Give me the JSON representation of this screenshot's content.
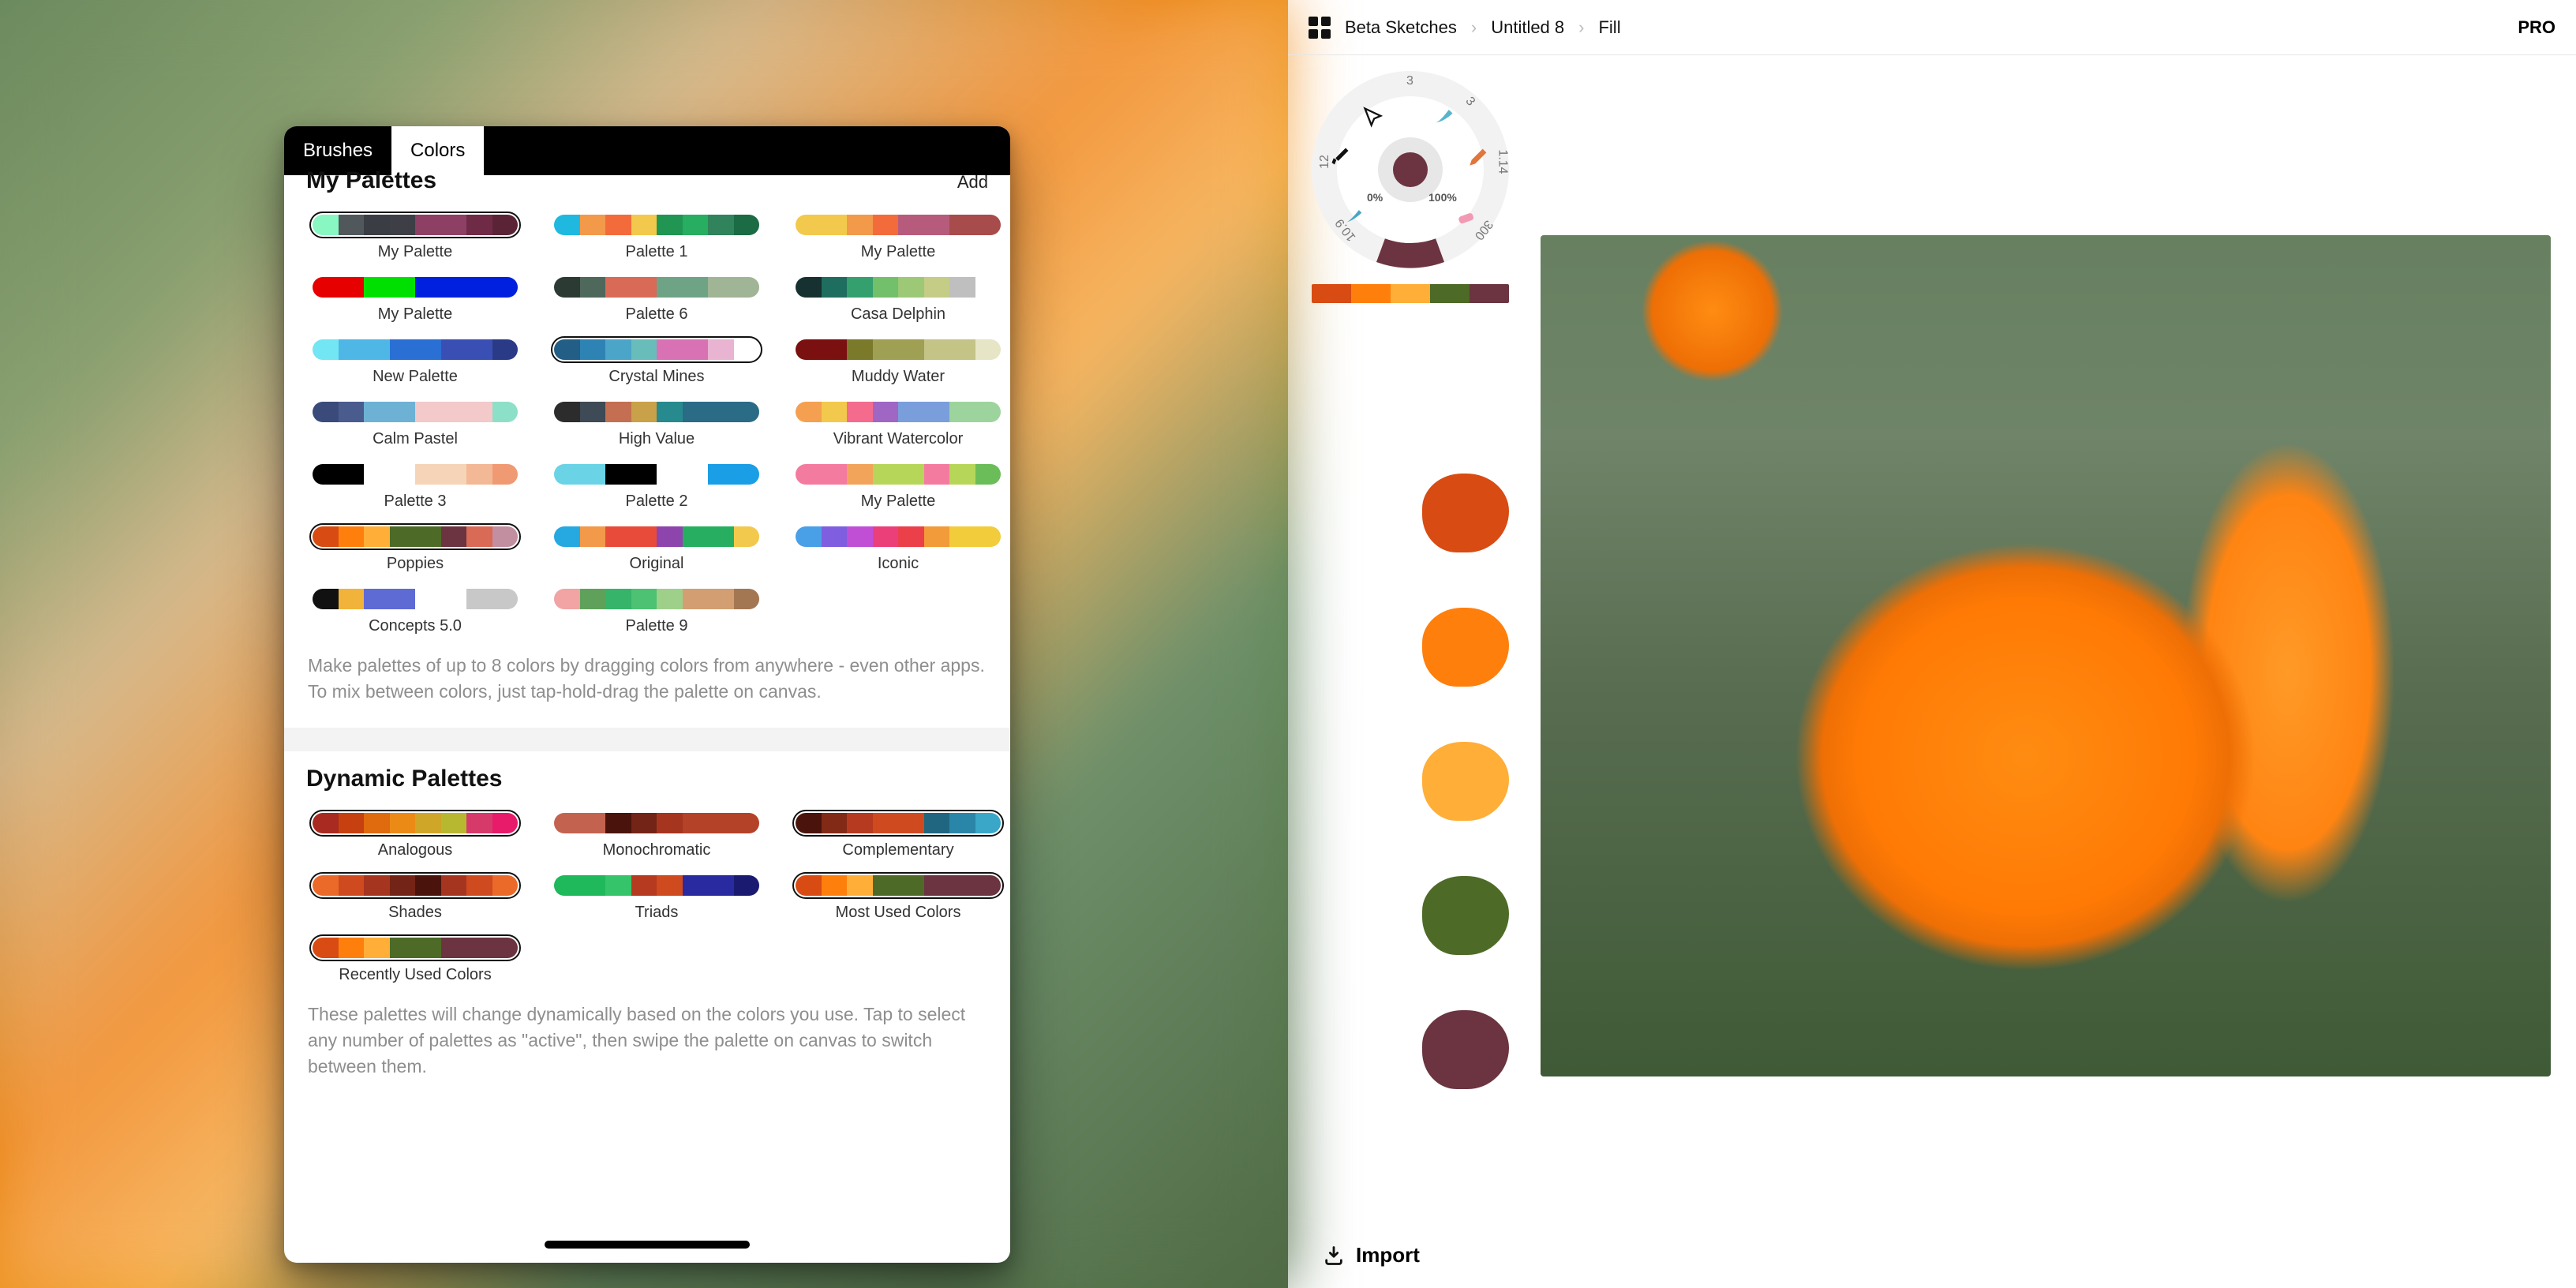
{
  "left": {
    "tabs": {
      "brushes": "Brushes",
      "colors": "Colors",
      "active": "colors"
    },
    "sections": {
      "my_palettes": {
        "title": "My Palettes",
        "add": "Add",
        "hint": "Make palettes of up to 8 colors by dragging colors from anywhere - even other apps. To mix between colors, just tap-hold-drag the palette on canvas.",
        "items": [
          {
            "label": "My Palette",
            "ring": true,
            "colors": [
              "#89f7c2",
              "#50585c",
              "#3a3e44",
              "#3e3f46",
              "#8d3f64",
              "#8d3f64",
              "#6f2a46",
              "#5a2436"
            ]
          },
          {
            "label": "Palette 1",
            "ring": false,
            "colors": [
              "#1fb9e0",
              "#f2994a",
              "#f46b3b",
              "#f2c94c",
              "#219653",
              "#27ae60",
              "#30835a",
              "#1b6b44"
            ]
          },
          {
            "label": "My Palette",
            "ring": false,
            "colors": [
              "#f2c94c",
              "#f2c94c",
              "#f2994a",
              "#f46b3b",
              "#b75b7c",
              "#b75b7c",
              "#a84b4b",
              "#a84b4b"
            ]
          },
          {
            "label": "My Palette",
            "ring": false,
            "colors": [
              "#e60000",
              "#e60000",
              "#00e000",
              "#00e000",
              "#0020e0",
              "#0020e0",
              "#0020e0",
              "#0020e0"
            ]
          },
          {
            "label": "Palette 6",
            "ring": false,
            "colors": [
              "#2b3a33",
              "#4f685c",
              "#d86a56",
              "#d86a56",
              "#6fa386",
              "#6fa386",
              "#a0b496",
              "#a0b496"
            ]
          },
          {
            "label": "Casa Delphin",
            "ring": false,
            "colors": [
              "#16312f",
              "#1f6d5e",
              "#33a06e",
              "#72c06a",
              "#9dc977",
              "#c5cc86",
              "#bfbfbf",
              "#ffffff"
            ]
          },
          {
            "label": "New Palette",
            "ring": false,
            "colors": [
              "#72e6f2",
              "#4fb7e6",
              "#4fb7e6",
              "#2a6fd4",
              "#2a6fd4",
              "#3a4fb4",
              "#3a4fb4",
              "#2a3a86"
            ]
          },
          {
            "label": "Crystal Mines",
            "ring": true,
            "colors": [
              "#225e86",
              "#2d84b4",
              "#4aa5c9",
              "#68bdbb",
              "#d872b4",
              "#d872b4",
              "#e9b4d2",
              "#ffffff"
            ]
          },
          {
            "label": "Muddy Water",
            "ring": false,
            "colors": [
              "#7a1010",
              "#7a1010",
              "#7a7a2a",
              "#a0a055",
              "#a0a055",
              "#c4c487",
              "#c4c487",
              "#e6e5c6"
            ]
          },
          {
            "label": "Calm Pastel",
            "ring": false,
            "colors": [
              "#3a4a7a",
              "#4a5b8e",
              "#6db2d4",
              "#6db2d4",
              "#f3c9c9",
              "#f3c9c9",
              "#f3c9c9",
              "#8de0c8"
            ]
          },
          {
            "label": "High Value",
            "ring": false,
            "colors": [
              "#2c2c2c",
              "#3e4a55",
              "#c46f52",
              "#c9a148",
              "#268a8e",
              "#2a6b86",
              "#2a6b86",
              "#2a6b86"
            ]
          },
          {
            "label": "Vibrant Watercolor",
            "ring": false,
            "colors": [
              "#f4a050",
              "#f2c94c",
              "#f46b8e",
              "#a066c4",
              "#7a9edc",
              "#7a9edc",
              "#9dd49d",
              "#9dd49d"
            ]
          },
          {
            "label": "Palette 3",
            "ring": false,
            "colors": [
              "#000000",
              "#000000",
              "#ffffff",
              "#ffffff",
              "#f6d4b8",
              "#f6d4b8",
              "#f3b895",
              "#f09a74"
            ]
          },
          {
            "label": "Palette 2",
            "ring": false,
            "colors": [
              "#6ad3e6",
              "#6ad3e6",
              "#000000",
              "#000000",
              "#ffffff",
              "#ffffff",
              "#1a9ee6",
              "#1a9ee6"
            ]
          },
          {
            "label": "My Palette",
            "ring": false,
            "colors": [
              "#f47ba0",
              "#f47ba0",
              "#f2a45a",
              "#b6d65a",
              "#b6d65a",
              "#f47ba0",
              "#b6d65a",
              "#6bbd5a"
            ]
          },
          {
            "label": "Poppies",
            "ring": true,
            "colors": [
              "#d84b12",
              "#ff7f0c",
              "#ffae38",
              "#4d6b26",
              "#4d6b26",
              "#6b3440",
              "#d86a56",
              "#c28fa0"
            ]
          },
          {
            "label": "Original",
            "ring": false,
            "colors": [
              "#26a9e0",
              "#f2994a",
              "#e84b3a",
              "#e84b3a",
              "#8e44ad",
              "#27ae60",
              "#27ae60",
              "#f2c94c"
            ]
          },
          {
            "label": "Iconic",
            "ring": false,
            "colors": [
              "#4aa0e6",
              "#7f5fe0",
              "#c04fd6",
              "#eb3f7a",
              "#eb3f4a",
              "#f29b3a",
              "#f2cc3a",
              "#f2cc3a"
            ]
          },
          {
            "label": "Concepts 5.0",
            "ring": false,
            "colors": [
              "#111111",
              "#f2b33a",
              "#5f6bd4",
              "#5f6bd4",
              "#ffffff",
              "#ffffff",
              "#c8c8c8",
              "#c8c8c8"
            ]
          },
          {
            "label": "Palette 9",
            "ring": false,
            "colors": [
              "#f2a3a3",
              "#5fa15a",
              "#36b46a",
              "#4cc272",
              "#9fd08a",
              "#d29e72",
              "#d29e72",
              "#a37752"
            ]
          }
        ]
      },
      "dynamic_palettes": {
        "title": "Dynamic Palettes",
        "hint": "These palettes will change dynamically based on the colors you use. Tap to select any number of palettes as \"active\", then swipe the palette on canvas to switch between them.",
        "items": [
          {
            "label": "Analogous",
            "ring": true,
            "colors": [
              "#a82a20",
              "#c74010",
              "#e06a0e",
              "#eb8b16",
              "#d0a628",
              "#b8b830",
              "#d63a6a",
              "#e81a6a"
            ]
          },
          {
            "label": "Monochromatic",
            "ring": false,
            "colors": [
              "#c46250",
              "#c46250",
              "#4a140c",
              "#742416",
              "#a63520",
              "#b44228",
              "#b44228",
              "#b44228"
            ]
          },
          {
            "label": "Complementary",
            "ring": true,
            "colors": [
              "#4a140c",
              "#832a16",
              "#b53a20",
              "#d04a20",
              "#d04a20",
              "#206680",
              "#2a86a8",
              "#3aa6c8"
            ]
          },
          {
            "label": "Shades",
            "ring": true,
            "colors": [
              "#eb6a2a",
              "#d04a20",
              "#a63520",
              "#742416",
              "#4a140c",
              "#a63520",
              "#d04a20",
              "#eb6a2a"
            ]
          },
          {
            "label": "Triads",
            "ring": false,
            "colors": [
              "#1fb85a",
              "#1fb85a",
              "#36c46a",
              "#b53a20",
              "#d04a20",
              "#2a2aa0",
              "#2a2aa0",
              "#1a1a70"
            ]
          },
          {
            "label": "Most Used Colors",
            "ring": true,
            "colors": [
              "#d84b12",
              "#ff7f0c",
              "#ffae38",
              "#4d6b26",
              "#4d6b26",
              "#6b3440",
              "#6b3440",
              "#6b3440"
            ]
          },
          {
            "label": "Recently Used Colors",
            "ring": true,
            "colors": [
              "#d84b12",
              "#ff7f0c",
              "#ffae38",
              "#4d6b26",
              "#4d6b26",
              "#6b3440",
              "#6b3440",
              "#6b3440"
            ]
          }
        ]
      }
    }
  },
  "right": {
    "breadcrumbs": [
      "Beta Sketches",
      "Untitled 8",
      "Fill"
    ],
    "breadcrumb_sep": "›",
    "pro": "PRO",
    "import": "Import",
    "swatchbar": [
      "#d84b12",
      "#ff7f0c",
      "#ffae38",
      "#4d6b26",
      "#6b3440"
    ],
    "blobs": [
      "#d84b12",
      "#ff7f0c",
      "#ffae38",
      "#4d6b26",
      "#6b3440"
    ],
    "wheel": {
      "brush_size_top": "3",
      "labels": [
        "3",
        "3",
        "1.14",
        "300",
        "10.9",
        "12"
      ],
      "pct_left": "0%",
      "pct_right": "100%"
    }
  }
}
